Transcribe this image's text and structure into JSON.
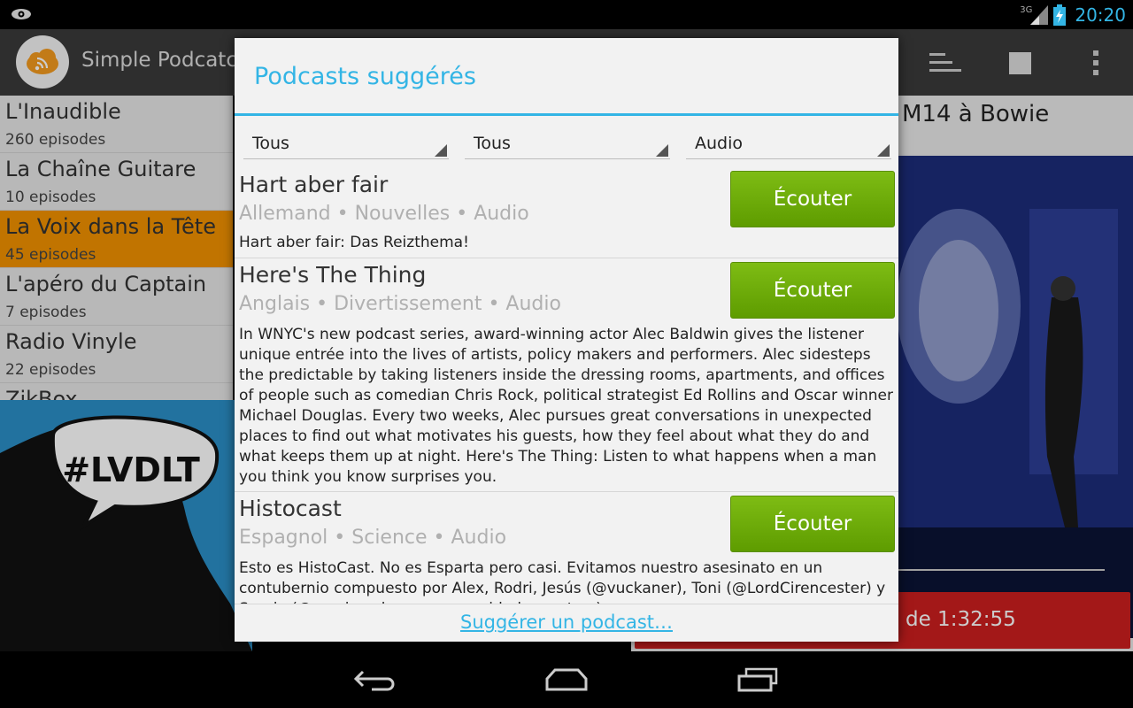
{
  "status_bar": {
    "network": "3G",
    "time": "20:20",
    "icons": [
      "eye-notification-icon",
      "signal-icon",
      "battery-charging-icon"
    ]
  },
  "action_bar": {
    "app_title": "Simple Podcatcher",
    "icons": [
      "app-logo-rss-icon",
      "sort-icon",
      "stop-icon",
      "overflow-menu-icon"
    ]
  },
  "podcasts": [
    {
      "name": "L'Inaudible",
      "count": "260 episodes",
      "active": false
    },
    {
      "name": "La Chaîne Guitare",
      "count": "10 episodes",
      "active": false
    },
    {
      "name": "La Voix dans la Tête",
      "count": "45 episodes",
      "active": true
    },
    {
      "name": "L'apéro du Captain",
      "count": "7 episodes",
      "active": false
    },
    {
      "name": "Radio Vinyle",
      "count": "22 episodes",
      "active": false
    },
    {
      "name": "ZikBox",
      "count": "",
      "active": false
    }
  ],
  "artwork": {
    "hashtag": "#LVDLT"
  },
  "episode": {
    "title": "M14 à Bowie",
    "player_time": "de 1:32:55"
  },
  "dialog": {
    "title": "Podcasts suggérés",
    "filters": {
      "language": "Tous",
      "category": "Tous",
      "type": "Audio"
    },
    "listen_label": "Écouter",
    "items": [
      {
        "title": "Hart aber fair",
        "meta": "Allemand • Nouvelles • Audio",
        "description": "Hart aber fair: Das Reizthema!"
      },
      {
        "title": "Here's The Thing",
        "meta": "Anglais • Divertissement • Audio",
        "description": "In WNYC's new podcast series, award-winning actor Alec Baldwin gives the  listener unique entrée into the lives of artists, policy makers and  performers.   Alec sidesteps the predictable by taking listeners inside the dressing  rooms, apartments, and offices of people such as comedian Chris Rock,  political strategist Ed Rollins and Oscar winner Michael Douglas.   Every two weeks, Alec pursues great conversations in unexpected places  to find out what motivates his guests, how they feel about what they do  and what keeps them up at night. Here's The Thing: Listen to what  happens when a man you think you know surprises you."
      },
      {
        "title": "Histocast",
        "meta": "Espagnol • Science • Audio",
        "description": "Esto es HistoCast. No es Esparta pero casi. Evitamos nuestro asesinato en un contubernio compuesto por Alex, Rodri, Jesús (@vuckaner), Toni (@LordCirencester) y Sergio (@sergiomcbea en comunidad con otros)..."
      }
    ],
    "footer_link": "Suggérer un podcast…"
  },
  "nav_bar": {
    "buttons": [
      "back-icon",
      "home-icon",
      "recent-apps-icon"
    ]
  }
}
